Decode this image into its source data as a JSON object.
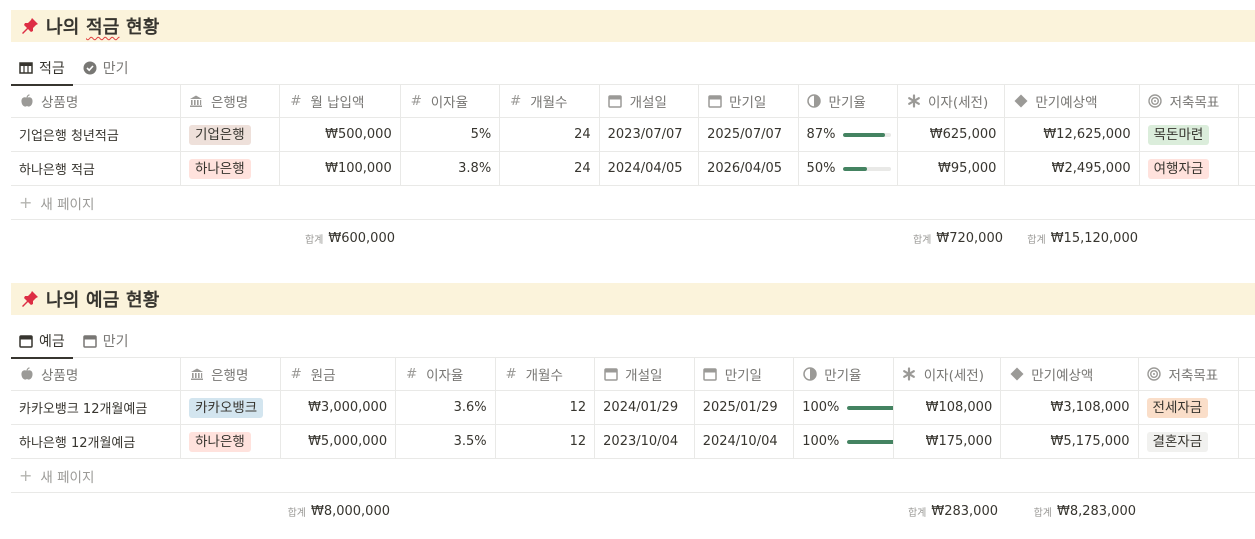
{
  "colors": {
    "callout_bg": "#fbf3db",
    "tag_gray": "#e3e2e0",
    "tag_brown": "#eee0da",
    "tag_red": "#ffe2dd",
    "tag_green": "#dbeddb",
    "tag_blue": "#d3e5ef",
    "tag_orange": "#fadec9",
    "tag_lightgray": "#f1f1ef",
    "progress_fill": "#448361"
  },
  "savings": {
    "title": "나의 적금 현황",
    "title_prefix": "나의 ",
    "title_squiggle": "적금",
    "title_suffix": " 현황",
    "tabs": [
      {
        "label": "적금",
        "icon": "table-icon",
        "active": true
      },
      {
        "label": "만기",
        "icon": "check-circle-icon",
        "active": false
      }
    ],
    "headers": [
      "상품명",
      "은행명",
      "월 납입액",
      "이자율",
      "개월수",
      "개설일",
      "만기일",
      "만기율",
      "이자(세전)",
      "만기예상액",
      "저축목표"
    ],
    "rows": [
      {
        "name": "기업은행 청년적금",
        "bank": "기업은행",
        "bank_color": "#eee0da",
        "amount": "₩500,000",
        "rate": "5%",
        "months": "24",
        "open": "2023/07/07",
        "maturity": "2025/07/07",
        "progress_label": "87%",
        "progress": 0.87,
        "interest": "₩625,000",
        "expected": "₩12,625,000",
        "goal": "목돈마련",
        "goal_color": "#dbeddb"
      },
      {
        "name": "하나은행 적금",
        "bank": "하나은행",
        "bank_color": "#ffe2dd",
        "amount": "₩100,000",
        "rate": "3.8%",
        "months": "24",
        "open": "2024/04/05",
        "maturity": "2026/04/05",
        "progress_label": "50%",
        "progress": 0.5,
        "interest": "₩95,000",
        "expected": "₩2,495,000",
        "goal": "여행자금",
        "goal_color": "#ffe2dd"
      }
    ],
    "new_page": "새 페이지",
    "sum_label": "합계",
    "sum_amount": "₩600,000",
    "sum_interest": "₩720,000",
    "sum_expected": "₩15,120,000"
  },
  "deposits": {
    "title": "나의 예금 현황",
    "tabs": [
      {
        "label": "예금",
        "icon": "calendar-icon",
        "active": true
      },
      {
        "label": "만기",
        "icon": "calendar-icon",
        "active": false
      }
    ],
    "headers": [
      "상품명",
      "은행명",
      "원금",
      "이자율",
      "개월수",
      "개설일",
      "만기일",
      "만기율",
      "이자(세전)",
      "만기예상액",
      "저축목표"
    ],
    "rows": [
      {
        "name": "카카오뱅크 12개월예금",
        "bank": "카카오뱅크",
        "bank_color": "#d3e5ef",
        "amount": "₩3,000,000",
        "rate": "3.6%",
        "months": "12",
        "open": "2024/01/29",
        "maturity": "2025/01/29",
        "progress_label": "100%",
        "progress": 1.0,
        "interest": "₩108,000",
        "expected": "₩3,108,000",
        "goal": "전세자금",
        "goal_color": "#fadec9"
      },
      {
        "name": "하나은행 12개월예금",
        "bank": "하나은행",
        "bank_color": "#ffe2dd",
        "amount": "₩5,000,000",
        "rate": "3.5%",
        "months": "12",
        "open": "2023/10/04",
        "maturity": "2024/10/04",
        "progress_label": "100%",
        "progress": 1.0,
        "interest": "₩175,000",
        "expected": "₩5,175,000",
        "goal": "결혼자금",
        "goal_color": "#f1f1ef"
      }
    ],
    "new_page": "새 페이지",
    "sum_label": "합계",
    "sum_amount": "₩8,000,000",
    "sum_interest": "₩283,000",
    "sum_expected": "₩8,283,000"
  }
}
